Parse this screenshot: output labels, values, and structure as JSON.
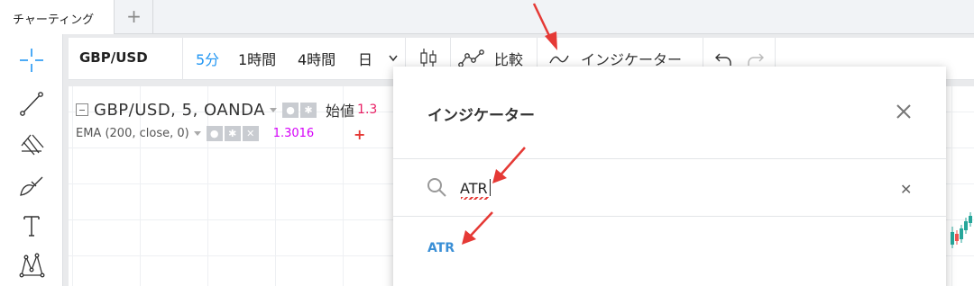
{
  "tabs": {
    "active_label": "チャーティング",
    "add_label": "+"
  },
  "toolbar": {
    "symbol": "GBP/USD",
    "timeframes": [
      "5分",
      "1時間",
      "4時間",
      "日"
    ],
    "active_timeframe": "5分",
    "compare_label": "比較",
    "indicators_label": "インジケーター"
  },
  "legend": {
    "main_title": "GBP/USD, 5, OANDA",
    "open_label": "始値",
    "open_value": "1.3",
    "ema_label": "EMA (200, close, 0)",
    "ema_value": "1.3016"
  },
  "modal": {
    "title": "インジケーター",
    "search_value": "ATR",
    "result_label": "ATR"
  },
  "colors": {
    "accent": "#2196f3",
    "result_link": "#3a8fd6",
    "annotation_red": "#e53935",
    "ema_value": "#d500f9",
    "open_value": "#e91e63"
  },
  "icons": [
    "crosshair-icon",
    "trendline-icon",
    "pitchfork-icon",
    "brush-icon",
    "text-icon",
    "pattern-icon",
    "candlestick-icon",
    "compare-icon",
    "indicator-icon",
    "undo-icon",
    "redo-icon",
    "search-icon",
    "close-icon"
  ]
}
